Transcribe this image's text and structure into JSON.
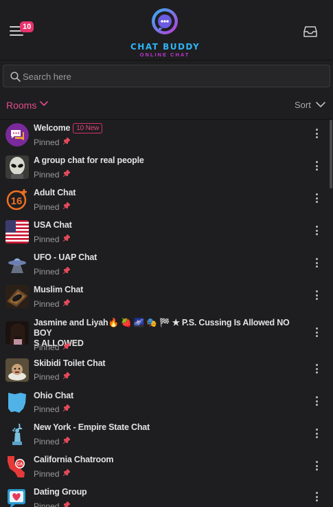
{
  "header": {
    "notification_count": "10",
    "logo_title": "CHAT BUDDY",
    "logo_subtitle": "ONLINE CHAT"
  },
  "search": {
    "placeholder": "Search here"
  },
  "toolbar": {
    "rooms_label": "Rooms",
    "sort_label": "Sort"
  },
  "colors": {
    "accent": "#e24a8d",
    "brand_blue": "#2fb3f5",
    "brand_purple": "#c338d6",
    "background": "#1e1e20"
  },
  "rooms": [
    {
      "name": "Welcome",
      "badge": "10 New",
      "status": "Pinned",
      "icon": "chat-bubbles-icon"
    },
    {
      "name": "A group chat for real people",
      "status": "Pinned",
      "icon": "alien-face-avatar"
    },
    {
      "name": "Adult Chat",
      "status": "Pinned",
      "icon": "sixteen-plus-icon"
    },
    {
      "name": "USA Chat",
      "status": "Pinned",
      "icon": "us-flag-icon"
    },
    {
      "name": "UFO - UAP Chat",
      "status": "Pinned",
      "icon": "ufo-icon"
    },
    {
      "name": "Muslim Chat",
      "status": "Pinned",
      "icon": "prayer-mat-avatar"
    },
    {
      "name": "Jasmine and Liyah🔥 🍓 🌌 🎭 🏁 ★ P.S. Cussing Is Allowed NO BOY",
      "name2": "S ALLOWED",
      "status": "Pinned",
      "icon": "profile-photo-avatar"
    },
    {
      "name": "Skibidi Toilet Chat",
      "status": "Pinned",
      "icon": "toilet-avatar"
    },
    {
      "name": "Ohio Chat",
      "status": "Pinned",
      "icon": "ohio-map-icon"
    },
    {
      "name": "New York - Empire State Chat",
      "status": "Pinned",
      "icon": "statue-of-liberty-icon"
    },
    {
      "name": "California Chatroom",
      "status": "Pinned",
      "icon": "california-map-icon"
    },
    {
      "name": "Dating Group",
      "status": "Pinned",
      "icon": "heart-chat-icon"
    }
  ]
}
